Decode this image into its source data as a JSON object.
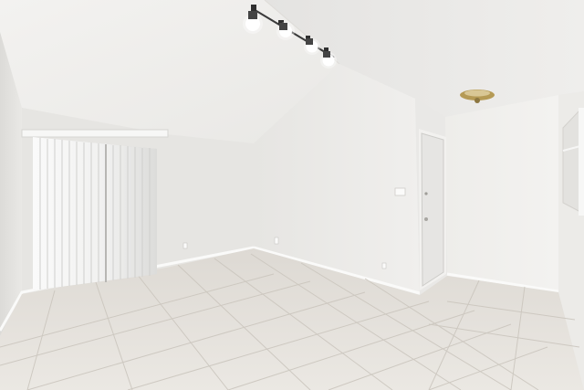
{
  "scene": {
    "type": "photo",
    "subject": "empty-room-interior",
    "elements": [
      "vaulted-ceiling",
      "track-lighting",
      "vertical-blinds",
      "sliding-door",
      "entry-door",
      "ceiling-light-fixture",
      "tile-floor",
      "wall-outlet",
      "light-switch-plate",
      "wall-niche"
    ]
  },
  "colors": {
    "ceiling": "#f2f1ef",
    "wall_left": "#e8e7e4",
    "wall_center": "#efefed",
    "wall_right": "#f1f0ee",
    "floor_tile": "#e4e0da",
    "grout": "#cfcac3",
    "blinds": "#f4f4f3",
    "door": "#ebeae8",
    "track": "#3a3a3a",
    "fixture_brass": "#b59a55"
  },
  "track_lights": {
    "count": 4
  }
}
